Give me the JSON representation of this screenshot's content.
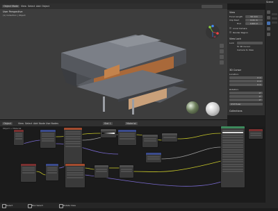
{
  "workspace_tabs": [
    "Modeling",
    "Sculpting",
    "UV Editing",
    "Texture Paint",
    "Shading",
    "Animation",
    "Rendering",
    "Compositing",
    "Geometry Nodes",
    "Scripting"
  ],
  "active_tab": "Shading",
  "scene_name": "Scene",
  "viewport": {
    "mode": "Object Mode",
    "menus": [
      "View",
      "Select",
      "Add",
      "Object"
    ],
    "overlay_title": "User Perspective",
    "overlay_sub": "(1) Collection | Object",
    "shading": "Material Preview"
  },
  "n_panel": {
    "view_header": "View",
    "focal_label": "Focal Length",
    "focal_value": "50 mm",
    "clip_start_label": "Clip Start",
    "clip_start_value": "0.01 m",
    "clip_end_label": "End",
    "clip_end_value": "1000 m",
    "local_camera_label": "Local Camera",
    "render_region_label": "Render Region",
    "view_lock_header": "View Lock",
    "lock_label": "Lock",
    "lock_cursor_label": "To 3D Cursor",
    "lock_camera_label": "Camera to View",
    "cursor_header": "3D Cursor",
    "location_label": "Location:",
    "cursor_x": "0 m",
    "cursor_y": "0 m",
    "cursor_z": "0 m",
    "rotation_label": "Rotation:",
    "rot_x": "0°",
    "rot_y": "0°",
    "rot_z": "0°",
    "rotation_mode": "XYZ Euler",
    "collections_header": "Collections"
  },
  "node_editor": {
    "object_label": "Object",
    "menus": [
      "View",
      "Select",
      "Add",
      "Node"
    ],
    "use_nodes_label": "Use Nodes",
    "slot_label": "Slot 1",
    "material_name": "Material",
    "breadcrumb": "Object > Material",
    "world_label": "Concrete"
  },
  "status": {
    "left": "Select",
    "middle": "Box Select",
    "right": "Rotate View"
  },
  "colors": {
    "accent_blue": "#4772b3",
    "node_shader": "#3d8a5c",
    "node_texture": "#a34b2e",
    "node_input": "#7a2f2f",
    "node_vector": "#3a4a8c",
    "node_group": "#4f4f4f",
    "link_yellow": "#c7c729",
    "link_purple": "#7a6bd1",
    "link_gray": "#a0a0a0"
  }
}
